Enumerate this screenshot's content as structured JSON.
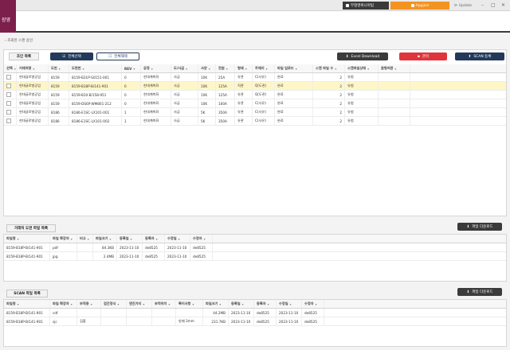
{
  "app": {
    "logo_text": "장영",
    "center_button": "부정영위니아팀",
    "app_button": "Appjoin",
    "update_label": "Update"
  },
  "breadcrumb": "조회된 스캔 승인",
  "top_section": {
    "label": "조인 목록",
    "select_all": "전체선택",
    "deselect_all": "전체해제",
    "excel": "Excel Download",
    "delete": "관리",
    "scan": "SCAN 등록",
    "columns": [
      "선택",
      "거래처명",
      "도번",
      "도면번",
      "REV",
      "공정",
      "도/사급",
      "사양",
      "전원",
      "형태",
      "주재지",
      "파일 업로드",
      "스캔 파일 수",
      "스캔파일상태",
      "참형여관"
    ],
    "rows": [
      {
        "company": "현대글로벌공업",
        "dobun": "8159",
        "drawing": "8159-B31P-S0151-001",
        "rev": "0",
        "process": "현대계측화",
        "supply": "사급",
        "spec": "10K",
        "power": "25A",
        "type": "유관",
        "material": "C(사유)",
        "upload": "완료",
        "count": "2",
        "status": "유첨",
        "selected": false
      },
      {
        "company": "현대글로벌공업",
        "dobun": "8159",
        "drawing": "8159-B18P-B/141-901",
        "rev": "0",
        "process": "현대계측화",
        "supply": "사급",
        "spec": "10K",
        "power": "125A",
        "type": "직관",
        "material": "Q(도관)",
        "upload": "완료",
        "count": "2",
        "status": "유첨",
        "selected": true
      },
      {
        "company": "현대글로벌공업",
        "dobun": "8159",
        "drawing": "8159-B10-B/158-951",
        "rev": "0",
        "process": "현대계측화",
        "supply": "사급",
        "spec": "10K",
        "power": "125A",
        "type": "유관",
        "material": "Q(도관)",
        "upload": "완료",
        "count": "2",
        "status": "유첨",
        "selected": false
      },
      {
        "company": "현대글로벌공업",
        "dobun": "8159",
        "drawing": "8159-DS6P-WM801-212",
        "rev": "0",
        "process": "현대계측화",
        "supply": "사급",
        "spec": "10K",
        "power": "100A",
        "type": "유관",
        "material": "C(사유)",
        "upload": "완료",
        "count": "2",
        "status": "유첨",
        "selected": false
      },
      {
        "company": "현대글로벌공업",
        "dobun": "8186",
        "drawing": "8186-E1SC-LX101-001",
        "rev": "1",
        "process": "현대계측화",
        "supply": "사급",
        "spec": "5K",
        "power": "350A",
        "type": "유관",
        "material": "C(사유)",
        "upload": "완료",
        "count": "2",
        "status": "유첨",
        "selected": false
      },
      {
        "company": "현대글로벌공업",
        "dobun": "8186",
        "drawing": "8186-E1SC-LX101-002",
        "rev": "1",
        "process": "현대계측화",
        "supply": "사급",
        "spec": "5K",
        "power": "350A",
        "type": "유관",
        "material": "C(사유)",
        "upload": "완료",
        "count": "2",
        "status": "유첨",
        "selected": false
      }
    ]
  },
  "middle_section": {
    "label": "거래처 도면 파일 목록",
    "download": "파일 다운로드",
    "columns": [
      "파일명",
      "파일 확장자",
      "비고",
      "파일크기",
      "등록일",
      "등록자",
      "수정일",
      "수정자"
    ],
    "rows": [
      {
        "name": "8159-B18P-B/141-901",
        "ext": "pdf",
        "note": "",
        "size": "84.3KB",
        "created": "2023-11-10",
        "creator": "de8525",
        "modified": "2023-11-10",
        "modifier": "de8525"
      },
      {
        "name": "8159-B18P-B/141-901",
        "ext": "jpg",
        "note": "",
        "size": "2.4MB",
        "created": "2023-11-10",
        "creator": "de8525",
        "modified": "2023-11-10",
        "modifier": "de8525"
      }
    ]
  },
  "bottom_section": {
    "label": "SCAN 파일 목록",
    "download": "파일 다운로드",
    "columns": [
      "파일명",
      "파일 확장자",
      "부적용",
      "검간정식",
      "엔진가지",
      "부적위치",
      "특이사항",
      "파일크기",
      "등록일",
      "등록자",
      "수정일",
      "수정자"
    ],
    "rows": [
      {
        "name": "8159-B18P-B/141-901",
        "ext": "cdf",
        "apply": "",
        "check": "",
        "engine": "",
        "pos": "",
        "remark": "",
        "size": "44.2MB",
        "created": "2023-11-10",
        "creator": "de8525",
        "modified": "2023-11-10",
        "modifier": "de8525"
      },
      {
        "name": "8159-B18P-B/141-901",
        "ext": "sjc",
        "apply": "검출",
        "check": "",
        "engine": "",
        "pos": "",
        "remark": "방제 3mm",
        "size": "231.7KB",
        "created": "2023-11-10",
        "creator": "de8525",
        "modified": "2023-11-10",
        "modifier": "de8525"
      }
    ]
  }
}
